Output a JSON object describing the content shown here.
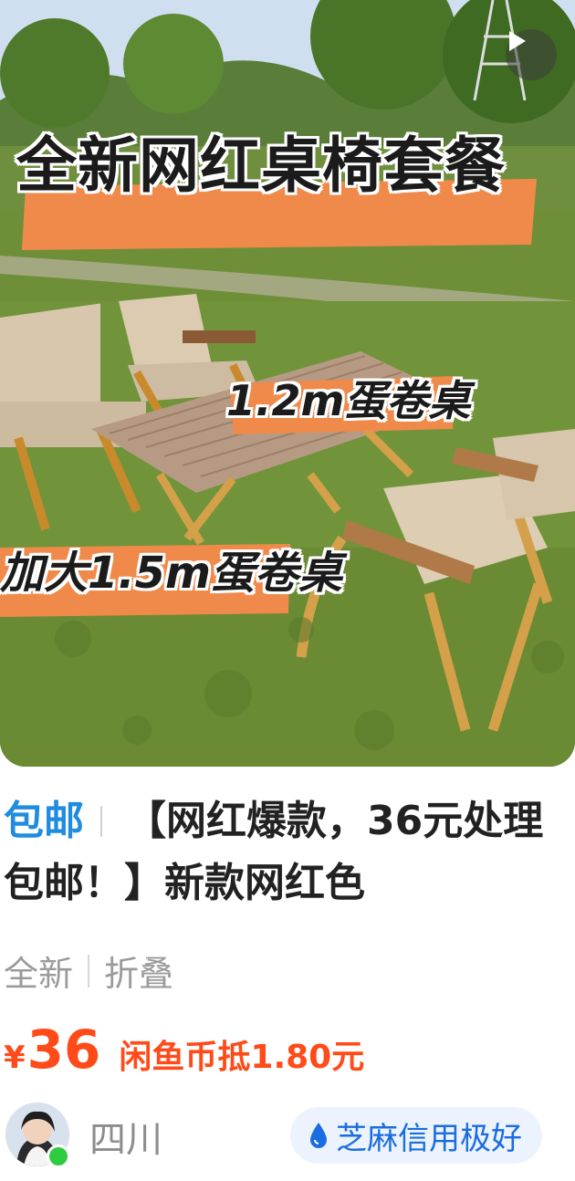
{
  "image": {
    "headline": "全新网红桌椅套餐",
    "label_small_table": "1.2m蛋卷桌",
    "label_large_table": "加大1.5m蛋卷桌",
    "play_icon": "play-icon"
  },
  "listing": {
    "tag": "包邮",
    "title": "【网红爆款，36元处理包邮！】新款网红色",
    "attributes": [
      "全新",
      "折叠"
    ],
    "currency": "¥",
    "price": "36",
    "coin_discount": "闲鱼币抵1.80元"
  },
  "seller": {
    "location": "四川",
    "credit": "芝麻信用极好",
    "credit_icon": "water-drop-icon"
  },
  "colors": {
    "accent_price": "#ff4b1a",
    "tag_blue": "#1f8ce0",
    "credit_text": "#1a6de0",
    "credit_bg": "#ecf3fe",
    "banner_orange": "#f08a4b"
  }
}
